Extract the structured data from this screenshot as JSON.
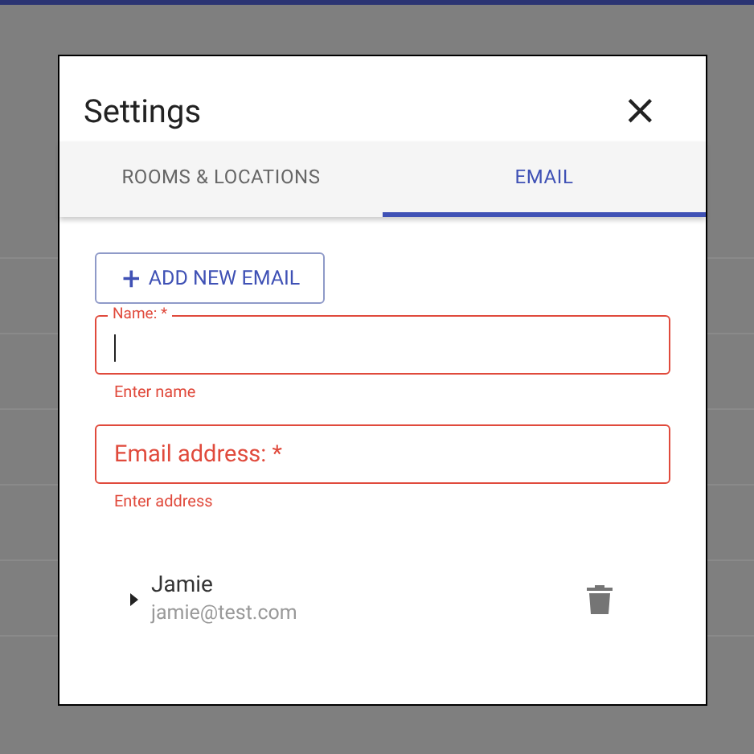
{
  "dialog": {
    "title": "Settings",
    "close": "×"
  },
  "tabs": [
    {
      "label": "ROOMS & LOCATIONS",
      "selected": false
    },
    {
      "label": "EMAIL",
      "selected": true
    }
  ],
  "add_button": {
    "icon": "+",
    "label": "ADD NEW EMAIL"
  },
  "fields": [
    {
      "label": "Name: *",
      "focused": true,
      "error": "Enter name"
    },
    {
      "label": "Email address: *",
      "focused": false,
      "error": "Enter address"
    }
  ],
  "entries": [
    {
      "name": "Jamie",
      "email": "jamie@test.com",
      "expanded": false
    }
  ]
}
